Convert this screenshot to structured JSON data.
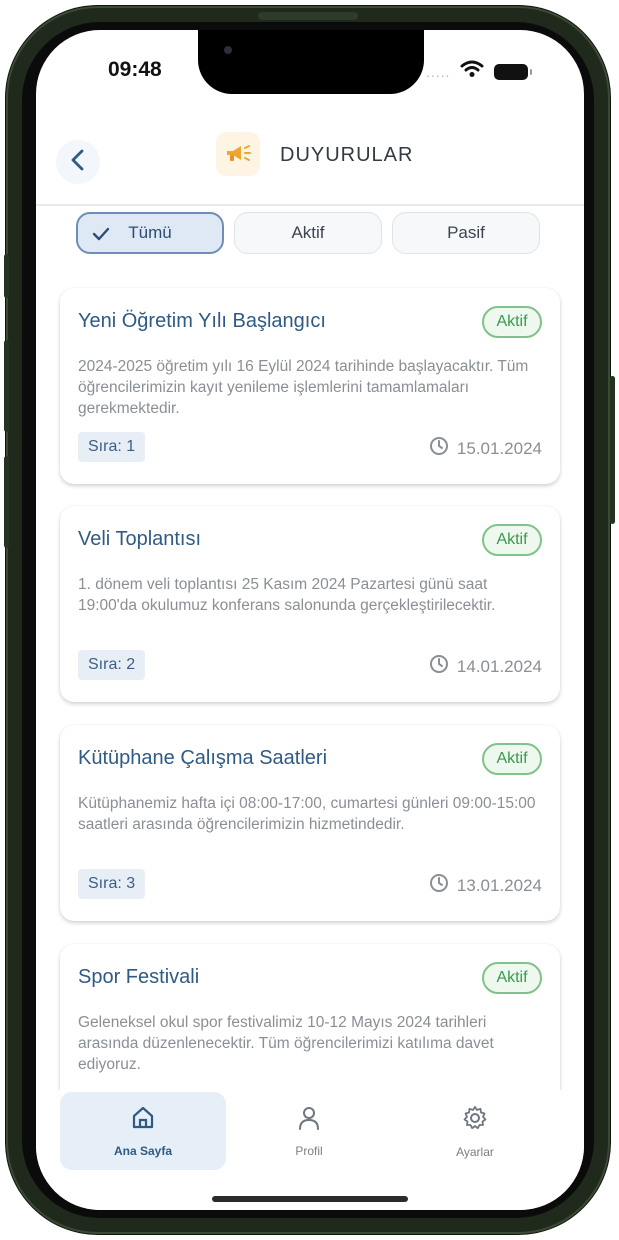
{
  "status": {
    "time": "09:48",
    "dots": "....."
  },
  "header": {
    "title": "DUYURULAR"
  },
  "filters": [
    {
      "label": "Tümü",
      "active": true
    },
    {
      "label": "Aktif",
      "active": false
    },
    {
      "label": "Pasif",
      "active": false
    }
  ],
  "cards": [
    {
      "title": "Yeni Öğretim Yılı Başlangıcı",
      "badge": "Aktif",
      "body": "2024-2025 öğretim yılı 16 Eylül 2024 tarihinde başlayacaktır. Tüm öğrencilerimizin kayıt yenileme işlemlerini tamamlamaları gerekmektedir.",
      "order": "Sıra: 1",
      "date": "15.01.2024"
    },
    {
      "title": "Veli Toplantısı",
      "badge": "Aktif",
      "body": "1. dönem veli toplantısı 25 Kasım 2024 Pazartesi günü saat 19:00'da okulumuz konferans salonunda gerçekleştirilecektir.",
      "order": "Sıra: 2",
      "date": "14.01.2024"
    },
    {
      "title": "Kütüphane Çalışma Saatleri",
      "badge": "Aktif",
      "body": "Kütüphanemiz hafta içi 08:00-17:00, cumartesi günleri 09:00-15:00 saatleri arasında öğrencilerimizin hizmetindedir.",
      "order": "Sıra: 3",
      "date": "13.01.2024"
    },
    {
      "title": "Spor Festivali",
      "badge": "Aktif",
      "body": "Geleneksel okul spor festivalimiz 10-12 Mayıs 2024 tarihleri arasında düzenlenecektir. Tüm öğrencilerimizi katılıma davet ediyoruz.",
      "order": "",
      "date": ""
    }
  ],
  "tabbar": [
    {
      "label": "Ana Sayfa",
      "icon": "home-icon",
      "active": true
    },
    {
      "label": "Profil",
      "icon": "user-icon",
      "active": false
    },
    {
      "label": "Ayarlar",
      "icon": "gear-icon",
      "active": false
    }
  ],
  "colors": {
    "accent": "#2f5a86",
    "badge_green": "#3a9a4a",
    "frame": "#1f2a1c"
  }
}
